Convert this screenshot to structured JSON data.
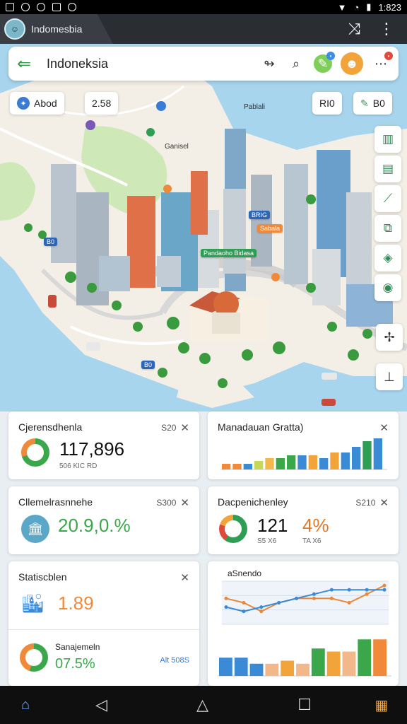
{
  "status": {
    "time": "1:823"
  },
  "appbar": {
    "tab_title": "Indomesbia"
  },
  "search": {
    "title": "Indoneksia"
  },
  "chips": {
    "left1": "Abod",
    "left2": "2.58",
    "right1": "RI0",
    "right2": "B0"
  },
  "map": {
    "labels": {
      "top": "Pablali",
      "top2": "Ganisel",
      "green_sign": "Pandaoho Bidasa",
      "orange_sign": "Sabala",
      "blue_sign": "BRIG",
      "blue_left": "B0",
      "blue_bottom": "B0"
    }
  },
  "cards": {
    "card1": {
      "title": "Cjerensdhenla",
      "meta": "S20",
      "value": "117,896",
      "sub": "506 KIC RD"
    },
    "card2": {
      "title": "Manadauan Gratta)"
    },
    "card3": {
      "title": "Cllemelrasnnehe",
      "meta": "S300",
      "value": "20.9,0.%"
    },
    "card4": {
      "title": "Dacpenichenley",
      "meta": "S210",
      "value": "121",
      "value2": "4%",
      "sub": "S5 X6",
      "sub2": "TA X6"
    },
    "card5": {
      "title": "Statiscblen",
      "value": "1.89",
      "title2": "Sanajemeln",
      "value2": "07.5%",
      "link": "Alt 508S"
    },
    "card6": {
      "title": "aSnendo"
    }
  },
  "colors": {
    "accent_green": "#2e9e44",
    "accent_orange": "#f2a33a",
    "chart_blue": "#3a8ad6"
  },
  "chart_data": [
    {
      "type": "bar",
      "categories": [
        "",
        "",
        "",
        "",
        "",
        "",
        "",
        "",
        "",
        "",
        "",
        "",
        "",
        "",
        ""
      ],
      "values": [
        2,
        2,
        2,
        3,
        4,
        4,
        5,
        5,
        5,
        4,
        6,
        6,
        8,
        10,
        11
      ],
      "ylim": [
        0,
        12
      ]
    },
    {
      "type": "line",
      "x": [
        1,
        2,
        3,
        4,
        5,
        6,
        7,
        8,
        9,
        10
      ],
      "series": [
        {
          "values": [
            6,
            5,
            3,
            5,
            6,
            6,
            6,
            5,
            7,
            9
          ]
        },
        {
          "values": [
            4,
            3,
            4,
            5,
            6,
            7,
            8,
            8,
            8,
            8
          ]
        }
      ],
      "ylim": [
        0,
        10
      ]
    },
    {
      "type": "bar",
      "categories": [
        "",
        "",
        "",
        "",
        "",
        "",
        "",
        "",
        "",
        "",
        ""
      ],
      "values": [
        6,
        6,
        4,
        4,
        5,
        4,
        9,
        8,
        8,
        12,
        12
      ],
      "ylim": [
        0,
        13
      ]
    }
  ]
}
